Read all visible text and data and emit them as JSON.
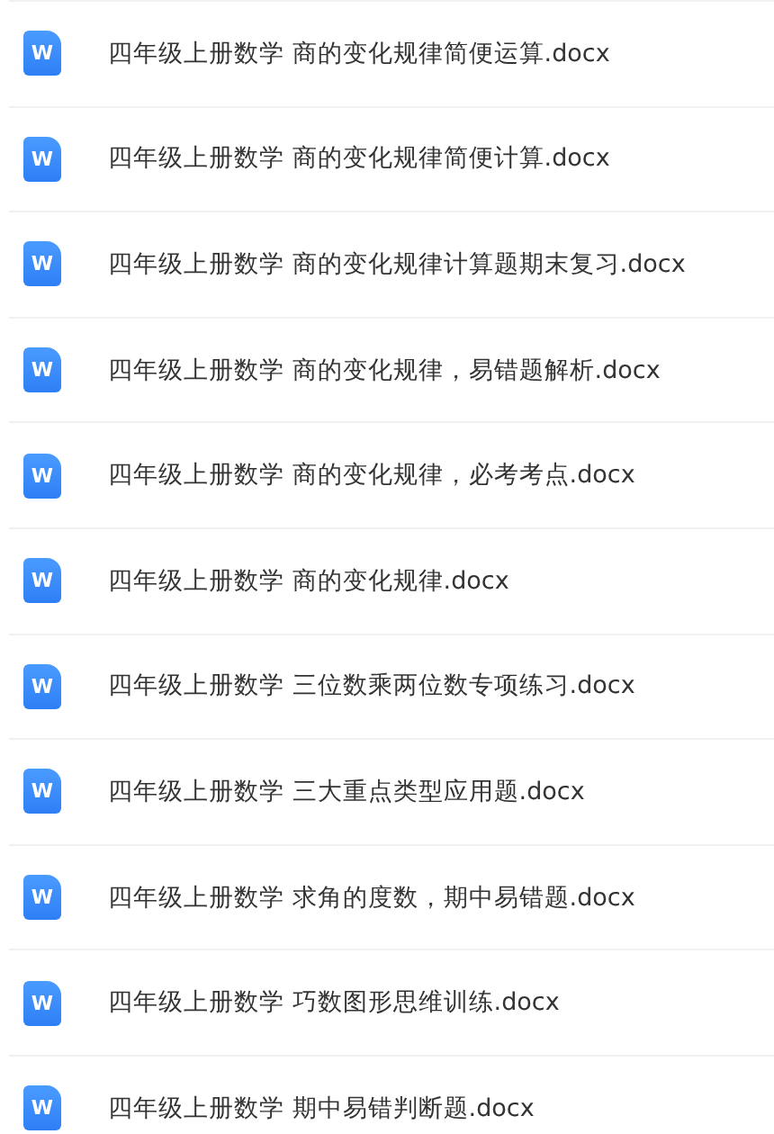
{
  "files": [
    {
      "icon_label": "W",
      "name": "四年级上册数学 商的变化规律简便运算.docx"
    },
    {
      "icon_label": "W",
      "name": "四年级上册数学 商的变化规律简便计算.docx"
    },
    {
      "icon_label": "W",
      "name": "四年级上册数学 商的变化规律计算题期末复习.docx"
    },
    {
      "icon_label": "W",
      "name": "四年级上册数学 商的变化规律，易错题解析.docx"
    },
    {
      "icon_label": "W",
      "name": "四年级上册数学 商的变化规律，必考考点.docx"
    },
    {
      "icon_label": "W",
      "name": "四年级上册数学 商的变化规律.docx"
    },
    {
      "icon_label": "W",
      "name": "四年级上册数学 三位数乘两位数专项练习.docx"
    },
    {
      "icon_label": "W",
      "name": "四年级上册数学 三大重点类型应用题.docx"
    },
    {
      "icon_label": "W",
      "name": "四年级上册数学 求角的度数，期中易错题.docx"
    },
    {
      "icon_label": "W",
      "name": "四年级上册数学 巧数图形思维训练.docx"
    },
    {
      "icon_label": "W",
      "name": "四年级上册数学 期中易错判断题.docx"
    }
  ]
}
